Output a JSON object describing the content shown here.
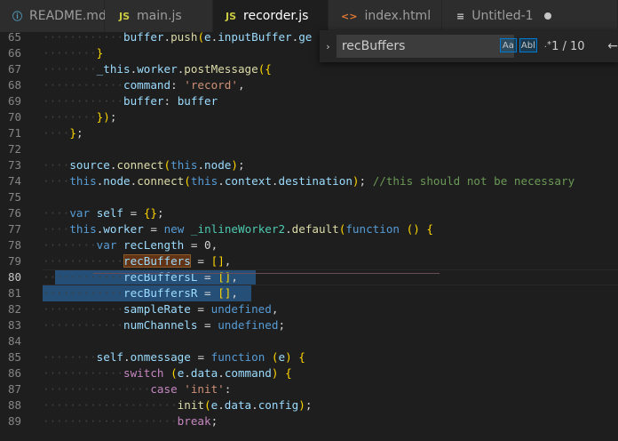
{
  "tabs": [
    {
      "label": "README.md",
      "icon": "info-icon",
      "glyph": "ⓘ",
      "active": false,
      "dirty": false
    },
    {
      "label": "main.js",
      "icon": "js-file-icon",
      "glyph": "JS",
      "active": false,
      "dirty": false
    },
    {
      "label": "recorder.js",
      "icon": "js-file-icon",
      "glyph": "JS",
      "active": true,
      "dirty": true
    },
    {
      "label": "index.html",
      "icon": "html-file-icon",
      "glyph": "<>",
      "active": false,
      "dirty": false
    },
    {
      "label": "Untitled-1",
      "icon": "text-file-icon",
      "glyph": "≡",
      "active": false,
      "dirty": true
    }
  ],
  "find": {
    "query": "recBuffers",
    "match_case_label": "Aa",
    "whole_word_label": "Abl",
    "regex_label": ".*",
    "count": "1 / 10",
    "expand_glyph": "›",
    "prev_glyph": "←"
  },
  "editor": {
    "current_line": 80,
    "lines": [
      {
        "n": "65",
        "t": "            buffer.push(e.inputBuffer.ge"
      },
      {
        "n": "66",
        "t": "        }"
      },
      {
        "n": "67",
        "t": "        _this.worker.postMessage({"
      },
      {
        "n": "68",
        "t": "            command: 'record',"
      },
      {
        "n": "69",
        "t": "            buffer: buffer"
      },
      {
        "n": "70",
        "t": "        });"
      },
      {
        "n": "71",
        "t": "    };"
      },
      {
        "n": "72",
        "t": ""
      },
      {
        "n": "73",
        "t": "    source.connect(this.node);"
      },
      {
        "n": "74",
        "t": "    this.node.connect(this.context.destination); //this should not be necessary"
      },
      {
        "n": "75",
        "t": ""
      },
      {
        "n": "76",
        "t": "    var self = {};"
      },
      {
        "n": "77",
        "t": "    this.worker = new _inlineWorker2.default(function () {"
      },
      {
        "n": "78",
        "t": "        var recLength = 0,"
      },
      {
        "n": "79",
        "t": "            recBuffers = [],"
      },
      {
        "n": "80",
        "t": "            recBuffersL = [],"
      },
      {
        "n": "81",
        "t": "            recBuffersR = [],"
      },
      {
        "n": "82",
        "t": "            sampleRate = undefined,"
      },
      {
        "n": "83",
        "t": "            numChannels = undefined;"
      },
      {
        "n": "84",
        "t": ""
      },
      {
        "n": "85",
        "t": "        self.onmessage = function (e) {"
      },
      {
        "n": "86",
        "t": "            switch (e.data.command) {"
      },
      {
        "n": "87",
        "t": "                case 'init':"
      },
      {
        "n": "88",
        "t": "                    init(e.data.config);"
      },
      {
        "n": "89",
        "t": "                    break;"
      }
    ]
  }
}
